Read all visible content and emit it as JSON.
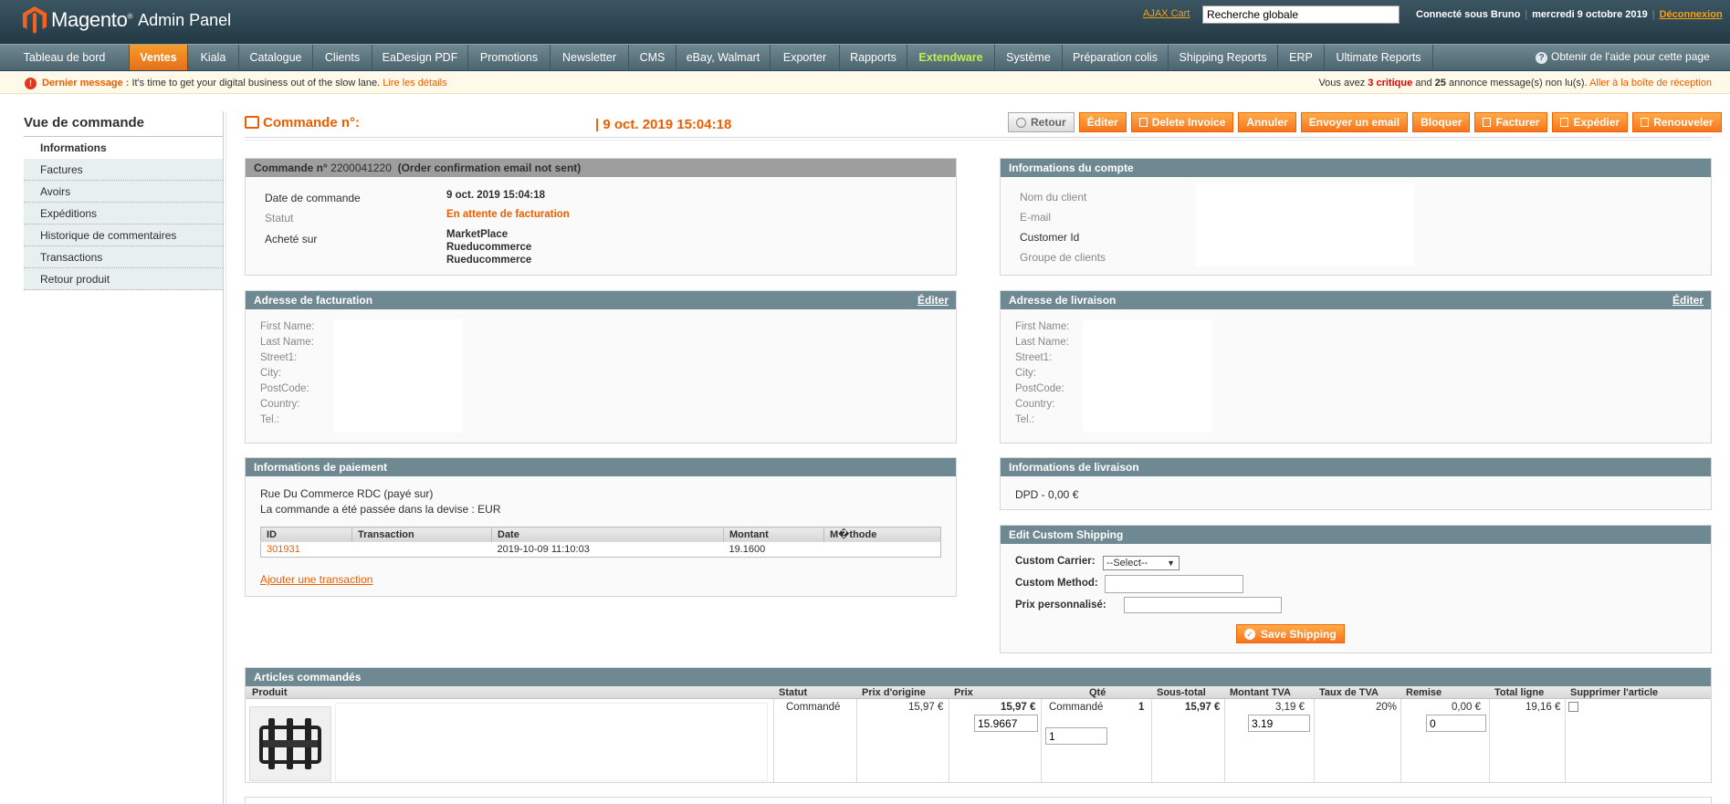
{
  "header": {
    "brand": "Magento",
    "trademark": "®",
    "subtitle": "Admin Panel",
    "ajax_cart": "AJAX Cart",
    "search_value": "Recherche globale",
    "logged_as": "Connecté sous Bruno",
    "date": "mercredi 9 octobre 2019",
    "logout": "Déconnexion"
  },
  "nav": {
    "items": [
      "Tableau de bord",
      "Ventes",
      "Kiala",
      "Catalogue",
      "Clients",
      "EaDesign PDF",
      "Promotions",
      "Newsletter",
      "CMS",
      "eBay, Walmart",
      "Exporter",
      "Rapports",
      "Extendware",
      "Système",
      "Préparation colis",
      "Shipping Reports",
      "ERP",
      "Ultimate Reports"
    ],
    "help": "Obtenir de l'aide pour cette page",
    "active_color": "#f18b22",
    "highlight_color": "#c0f04b"
  },
  "notice": {
    "label": "Dernier message :",
    "text": "It's time to get your digital business out of the slow lane.",
    "link": "Lire les détails",
    "right_pre": "Vous avez",
    "critical_count": "3",
    "critical": "critique",
    "and": "and",
    "count": "25",
    "right_post": "annonce message(s) non lu(s).",
    "right_link": "Aller à la boîte de réception"
  },
  "sidebar": {
    "title": "Vue de commande",
    "tabs": [
      "Informations",
      "Factures",
      "Avoirs",
      "Expéditions",
      "Historique de commentaires",
      "Transactions",
      "Retour produit"
    ]
  },
  "page": {
    "title": "Commande n°:",
    "date": "| 9 oct. 2019 15:04:18"
  },
  "toolbar": {
    "buttons": [
      "Retour",
      "Éditer",
      "Delete Invoice",
      "Annuler",
      "Envoyer un email",
      "Bloquer",
      "Facturer",
      "Expédier",
      "Renouveler"
    ]
  },
  "order": {
    "header_pre": "Commande n°",
    "number": "2200041220",
    "header_post": "(Order confirmation email not sent)",
    "date_label": "Date de commande",
    "date_value": "9 oct. 2019 15:04:18",
    "status_label": "Statut",
    "status_value": "En attente de facturation",
    "bought_label": "Acheté sur",
    "bought_lines": [
      "MarketPlace",
      "Rueducommerce",
      "Rueducommerce"
    ]
  },
  "account": {
    "title": "Informations du compte",
    "labels": [
      "Nom du client",
      "E-mail",
      "Customer Id",
      "Groupe de clients"
    ]
  },
  "billing": {
    "title": "Adresse de facturation",
    "edit": "Éditer",
    "fields": [
      "First Name:",
      "Last Name:",
      "Street1:",
      "City:",
      "PostCode:",
      "Country:",
      "Tel.:"
    ]
  },
  "shipping_addr": {
    "title": "Adresse de livraison",
    "edit": "Éditer",
    "fields": [
      "First Name:",
      "Last Name:",
      "Street1:",
      "City:",
      "PostCode:",
      "Country:",
      "Tel.:"
    ]
  },
  "payment": {
    "title": "Informations de paiement",
    "line1": "Rue Du Commerce RDC (payé sur)",
    "line2": "La commande a été passée dans la devise : EUR",
    "columns": [
      "ID",
      "Transaction",
      "Date",
      "Montant",
      "M�thode"
    ],
    "row": {
      "id": "301931",
      "transaction": "",
      "date": "2019-10-09 11:10:03",
      "amount": "19.1600",
      "method": ""
    },
    "add_link": "Ajouter une transaction"
  },
  "delivery": {
    "title": "Informations de livraison",
    "text": "DPD - 0,00 €"
  },
  "custom_shipping": {
    "title": "Edit Custom Shipping",
    "carrier_label": "Custom Carrier:",
    "carrier_value": "--Select--",
    "method_label": "Custom Method:",
    "price_label": "Prix personnalisé:",
    "save": "Save Shipping"
  },
  "items": {
    "title": "Articles commandés",
    "columns": [
      "Produit",
      "Statut",
      "Prix d'origine",
      "Prix",
      "Qté",
      "Sous-total",
      "Montant TVA",
      "Taux de TVA",
      "Remise",
      "Total ligne",
      "Supprimer l'article"
    ],
    "row": {
      "status": "Commandé",
      "original_price": "15,97 €",
      "price": "15,97 €",
      "price_input": "15.9667",
      "qty_label": "Commandé",
      "qty": "1",
      "qty_input": "1",
      "subtotal": "15,97 €",
      "tax": "3,19 €",
      "tax_input": "3.19",
      "tax_rate": "20%",
      "discount": "0,00 €",
      "discount_input": "0",
      "row_total": "19,16 €"
    }
  }
}
